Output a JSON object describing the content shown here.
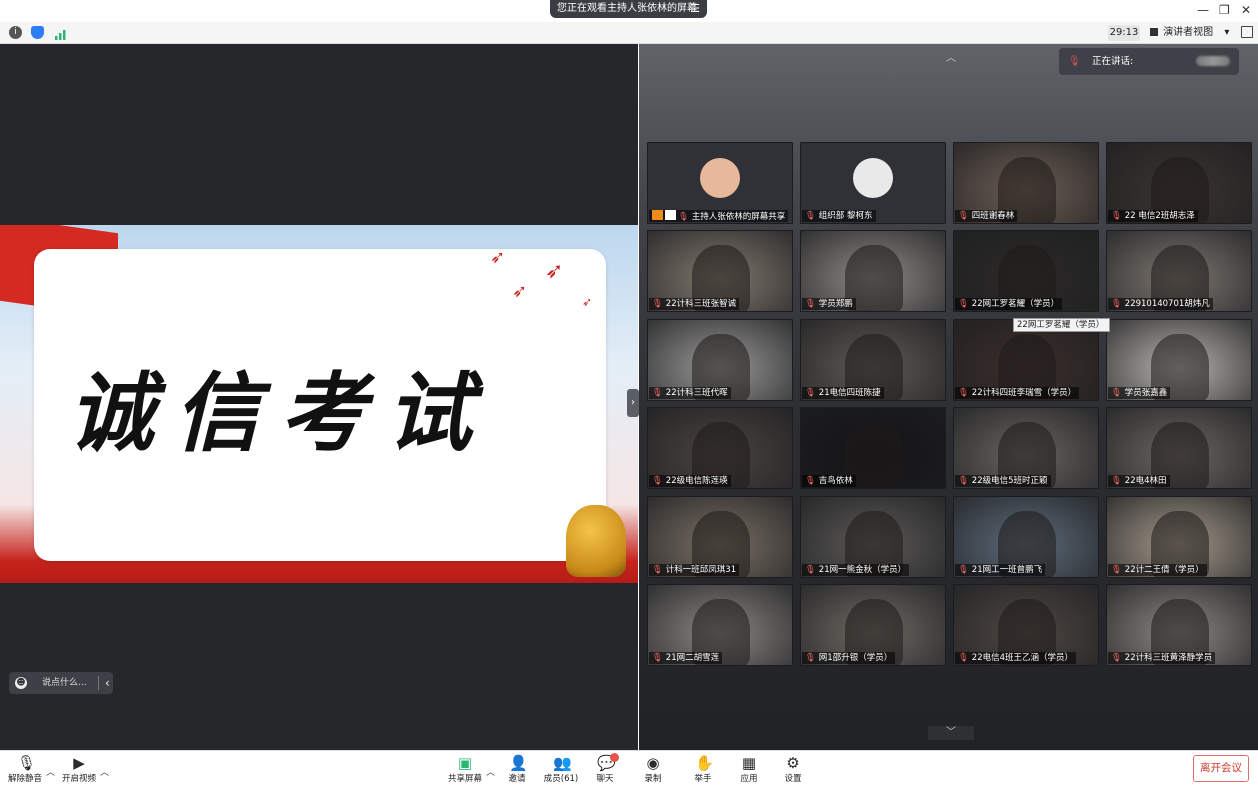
{
  "share_banner": {
    "text": "您正在观看主持人张依林的屏幕",
    "menu_icon": "menu-icon"
  },
  "window": {
    "minimize": "—",
    "restore": "❐",
    "close": "✕"
  },
  "toolbar": {
    "timer": "29:13",
    "view_label": "演讲者视图",
    "view_caret": "▾"
  },
  "slide": {
    "title": "诚信考试"
  },
  "chat": {
    "placeholder": "说点什么..."
  },
  "speaking": {
    "label": "正在讲话:"
  },
  "tooltip": "22网工罗茗耀（学员）",
  "participants": [
    {
      "name": "主持人张依林的屏幕共享",
      "bg": "#2f3136",
      "avatar": "#e8b89a"
    },
    {
      "name": "组织部 黎柯东",
      "bg": "#2f3136",
      "avatar": "#e9e9e9"
    },
    {
      "name": "四班谢春林",
      "bg": "#6d5f55"
    },
    {
      "name": "22 电信2班胡志泽",
      "bg": "#3a3431"
    },
    {
      "name": "22计科三班张智诚",
      "bg": "#837a70"
    },
    {
      "name": "学员郑鹏",
      "bg": "#8f8a86"
    },
    {
      "name": "22网工罗茗耀（学员）",
      "bg": "#2c2a28"
    },
    {
      "name": "22910140701胡炜凡",
      "bg": "#7d7771"
    },
    {
      "name": "22计科三班代晖",
      "bg": "#9a9a98"
    },
    {
      "name": "21电信四班陈捷",
      "bg": "#5e5a55"
    },
    {
      "name": "22计科四班李瑞雪（学员）",
      "bg": "#3b2f2b"
    },
    {
      "name": "学员张嘉鑫",
      "bg": "#b8b5b0"
    },
    {
      "name": "22级电信陈莲瑛",
      "bg": "#4a4440"
    },
    {
      "name": "吉鸟依林",
      "bg": "#141416"
    },
    {
      "name": "22级电信5班时正颖",
      "bg": "#686460"
    },
    {
      "name": "22电4林田",
      "bg": "#6b6662"
    },
    {
      "name": "计科一班邱凤琪31",
      "bg": "#7a7065"
    },
    {
      "name": "21网一熊金秋（学员）",
      "bg": "#5c5a58"
    },
    {
      "name": "21网工一班曾鹏飞",
      "bg": "#5e6c7a"
    },
    {
      "name": "22计二王倩（学员）",
      "bg": "#a49a8c"
    },
    {
      "name": "21网二胡雪莲",
      "bg": "#8b8783"
    },
    {
      "name": "网1邵升银（学员）",
      "bg": "#6e6a64"
    },
    {
      "name": "22电信4班王乙涵（学员）",
      "bg": "#4f4843"
    },
    {
      "name": "22计科三班黄泽静学员",
      "bg": "#8c8782"
    }
  ],
  "bottom": {
    "mute": "解除静音",
    "video": "开启视频",
    "share": "共享屏幕",
    "invite": "邀请",
    "members": "成员(61)",
    "chat": "聊天",
    "record": "录制",
    "raise": "举手",
    "apps": "应用",
    "settings": "设置",
    "leave": "离开会议"
  },
  "colors": {
    "accent_red": "#d0392b",
    "share_green": "#2bb673",
    "shield_blue": "#2d7df6"
  }
}
